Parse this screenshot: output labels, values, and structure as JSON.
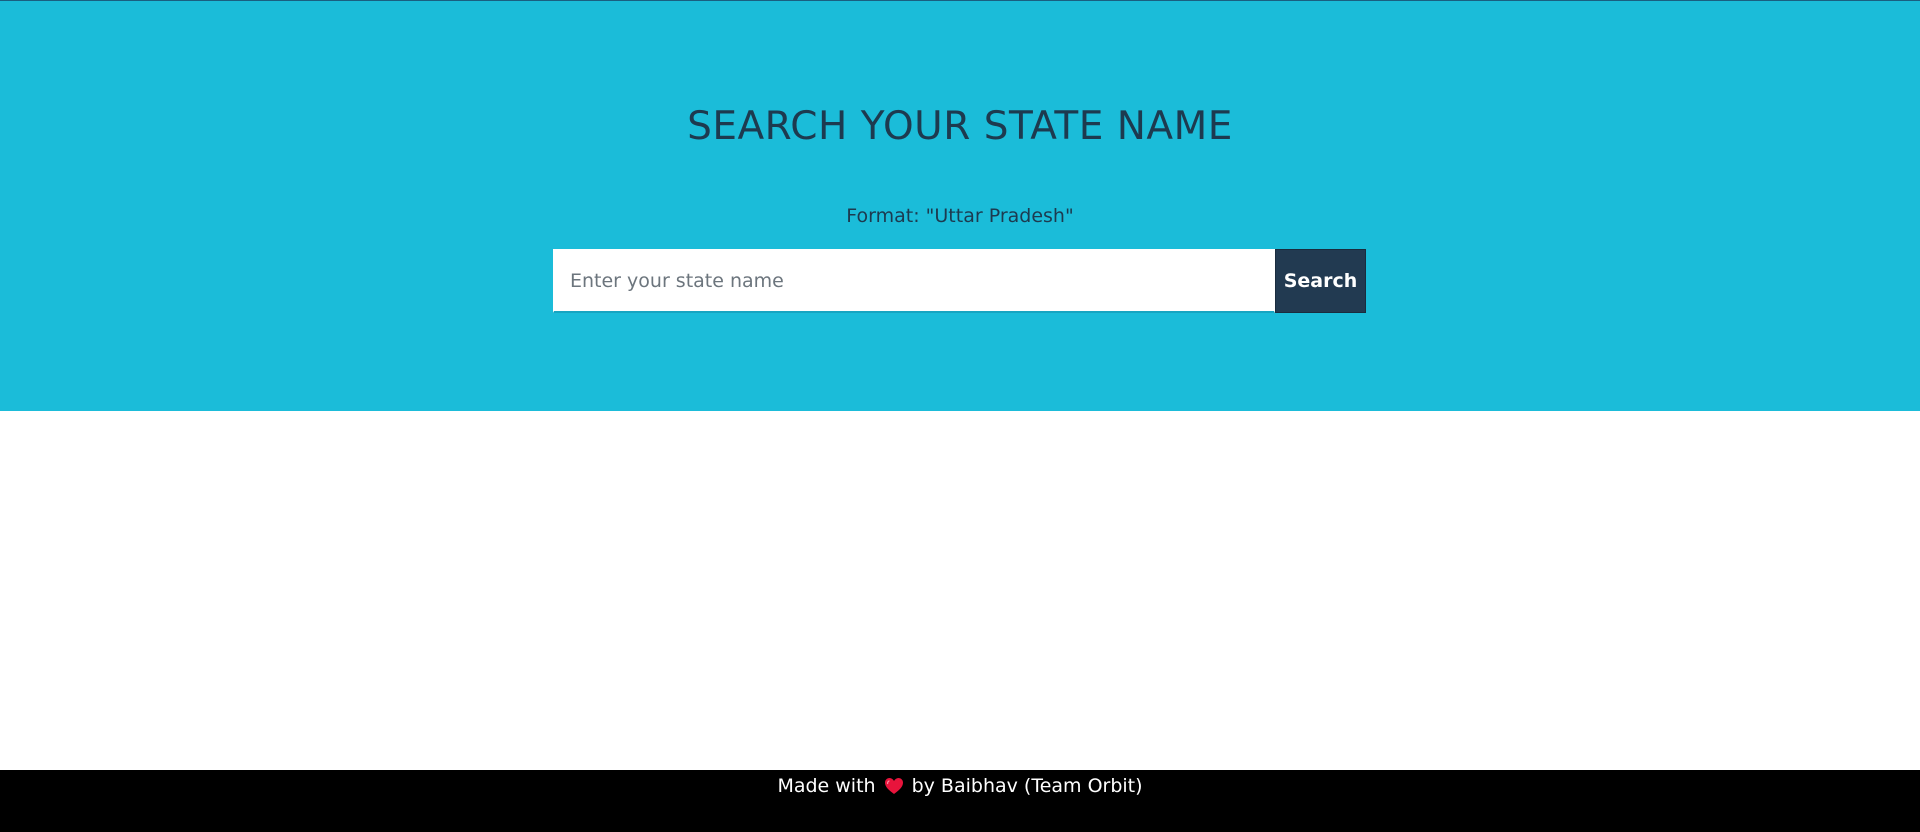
{
  "hero": {
    "title": "SEARCH YOUR STATE NAME",
    "format_hint": "Format: \"Uttar Pradesh\"",
    "background_color": "#1bbcd9",
    "text_color": "#1d3a4f"
  },
  "search": {
    "placeholder": "Enter your state name",
    "value": "",
    "button_label": "Search",
    "button_color": "#223a51"
  },
  "footer": {
    "prefix": "Made with",
    "icon": "heart-icon",
    "suffix": "by Baibhav (Team Orbit)",
    "heart_color": "#e8143c"
  }
}
